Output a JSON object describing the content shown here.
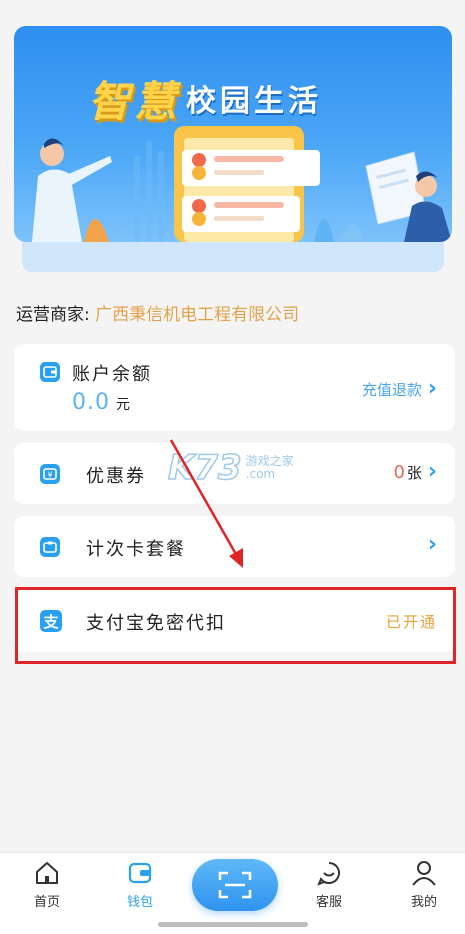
{
  "banner": {
    "title_big": "智慧",
    "title_small": "校园生活"
  },
  "merchant": {
    "label": "运营商家:",
    "name": "广西秉信机电工程有限公司"
  },
  "account": {
    "title": "账户余额",
    "balance": "0.0",
    "unit": "元",
    "action": "充值退款"
  },
  "coupon": {
    "title": "优惠券",
    "count": "0",
    "unit": "张"
  },
  "package": {
    "title": "计次卡套餐"
  },
  "alipay": {
    "icon_char": "支",
    "title": "支付宝免密代扣",
    "status": "已开通"
  },
  "watermark": {
    "text": "K73",
    "sub1": "游戏之家",
    "sub2": ".com"
  },
  "nav": {
    "home": "首页",
    "wallet": "钱包",
    "service": "客服",
    "mine": "我的"
  },
  "colors": {
    "accent": "#2aa1f0",
    "merchant": "#e3a24a",
    "status": "#e8a23a",
    "highlight": "#e0252a"
  }
}
